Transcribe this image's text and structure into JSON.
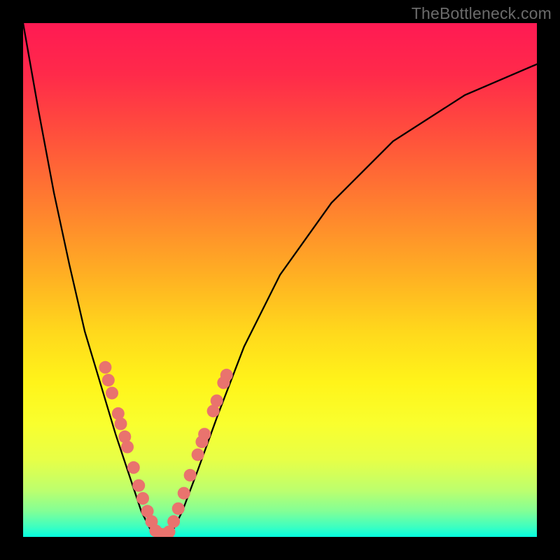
{
  "watermark": "TheBottleneck.com",
  "chart_data": {
    "type": "line",
    "title": "",
    "xlabel": "",
    "ylabel": "",
    "xlim": [
      0,
      100
    ],
    "ylim": [
      0,
      100
    ],
    "grid": false,
    "legend": false,
    "description": "V-shaped bottleneck curve over a vertical red→yellow→green gradient.",
    "minimum_x": 27,
    "series": [
      {
        "name": "curve",
        "x": [
          0,
          3,
          6,
          9,
          12,
          15,
          18,
          21,
          23,
          25,
          27,
          29,
          31,
          34,
          38,
          43,
          50,
          60,
          72,
          86,
          100
        ],
        "y": [
          100,
          83,
          67,
          53,
          40,
          30,
          20,
          11,
          5,
          1,
          0,
          1,
          5,
          13,
          24,
          37,
          51,
          65,
          77,
          86,
          92
        ]
      }
    ],
    "marker_clusters": [
      {
        "name": "left-arm-markers",
        "points": [
          {
            "x": 16.0,
            "y": 33.0
          },
          {
            "x": 16.6,
            "y": 30.5
          },
          {
            "x": 17.3,
            "y": 28.0
          },
          {
            "x": 18.5,
            "y": 24.0
          },
          {
            "x": 19.0,
            "y": 22.0
          },
          {
            "x": 19.8,
            "y": 19.5
          },
          {
            "x": 20.3,
            "y": 17.5
          },
          {
            "x": 21.5,
            "y": 13.5
          },
          {
            "x": 22.5,
            "y": 10.0
          },
          {
            "x": 23.3,
            "y": 7.5
          },
          {
            "x": 24.2,
            "y": 5.0
          },
          {
            "x": 25.0,
            "y": 3.0
          }
        ]
      },
      {
        "name": "right-arm-markers",
        "points": [
          {
            "x": 29.3,
            "y": 3.0
          },
          {
            "x": 30.2,
            "y": 5.5
          },
          {
            "x": 31.3,
            "y": 8.5
          },
          {
            "x": 32.5,
            "y": 12.0
          },
          {
            "x": 34.0,
            "y": 16.0
          },
          {
            "x": 34.8,
            "y": 18.5
          },
          {
            "x": 35.3,
            "y": 20.0
          },
          {
            "x": 37.0,
            "y": 24.5
          },
          {
            "x": 37.7,
            "y": 26.5
          },
          {
            "x": 39.0,
            "y": 30.0
          },
          {
            "x": 39.6,
            "y": 31.5
          }
        ]
      },
      {
        "name": "trough-markers",
        "points": [
          {
            "x": 25.8,
            "y": 1.2
          },
          {
            "x": 26.6,
            "y": 0.6
          },
          {
            "x": 27.5,
            "y": 0.5
          },
          {
            "x": 28.4,
            "y": 1.0
          }
        ]
      }
    ],
    "background_gradient": {
      "orientation": "vertical",
      "stops": [
        {
          "pos": 0.0,
          "color": "#ff1a53"
        },
        {
          "pos": 0.2,
          "color": "#ff4a3e"
        },
        {
          "pos": 0.4,
          "color": "#ff8f2b"
        },
        {
          "pos": 0.6,
          "color": "#ffd81c"
        },
        {
          "pos": 0.78,
          "color": "#f9ff2e"
        },
        {
          "pos": 0.91,
          "color": "#bcff6e"
        },
        {
          "pos": 1.0,
          "color": "#05ffe0"
        }
      ]
    },
    "marker_style": {
      "color": "#e9736e",
      "radius_px": 9
    }
  }
}
